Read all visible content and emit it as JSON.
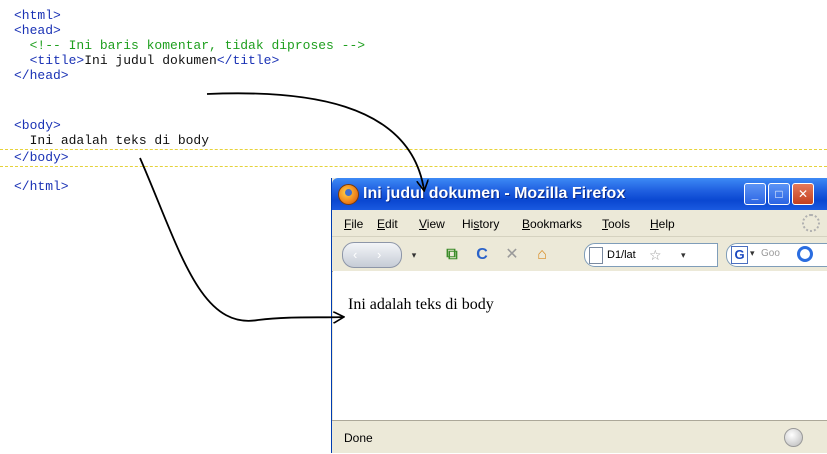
{
  "editor": {
    "lines": {
      "html_open": "<html>",
      "head_open": "<head>",
      "comment": "<!-- Ini baris komentar, tidak diproses -->",
      "title_open": "<title>",
      "title_text": "Ini judul dokumen",
      "title_close": "</title>",
      "head_close": "</head>",
      "body_open": "<body>",
      "body_text": "Ini adalah teks di body",
      "body_close": "</body>",
      "html_close": "</html>"
    },
    "colors": {
      "tag": "#1a32b5",
      "comment": "#1f9f1f",
      "text": "#111111",
      "highlight_dash": "#e6d23a"
    }
  },
  "browser": {
    "title": "Ini judul dokumen - Mozilla Firefox",
    "menu": [
      {
        "pre": "",
        "u": "F",
        "post": "ile"
      },
      {
        "pre": "",
        "u": "E",
        "post": "dit"
      },
      {
        "pre": "",
        "u": "V",
        "post": "iew"
      },
      {
        "pre": "Hi",
        "u": "s",
        "post": "tory"
      },
      {
        "pre": "",
        "u": "B",
        "post": "ookmarks"
      },
      {
        "pre": "",
        "u": "T",
        "post": "ools"
      },
      {
        "pre": "",
        "u": "H",
        "post": "elp"
      }
    ],
    "address_value": "D1/lat",
    "search_placeholder": "Goo",
    "content_text": "Ini adalah teks di body",
    "status": "Done",
    "icons": [
      "back-icon",
      "forward-icon",
      "history-dropdown-icon",
      "bookmark-add-icon",
      "reload-icon",
      "stop-icon",
      "home-icon",
      "page-icon",
      "star-icon",
      "google-icon",
      "magnifier-icon",
      "firefox-logo-icon",
      "throbber-icon"
    ],
    "colors": {
      "titlebar": "#0a47d1",
      "chrome": "#ece9d8"
    }
  }
}
